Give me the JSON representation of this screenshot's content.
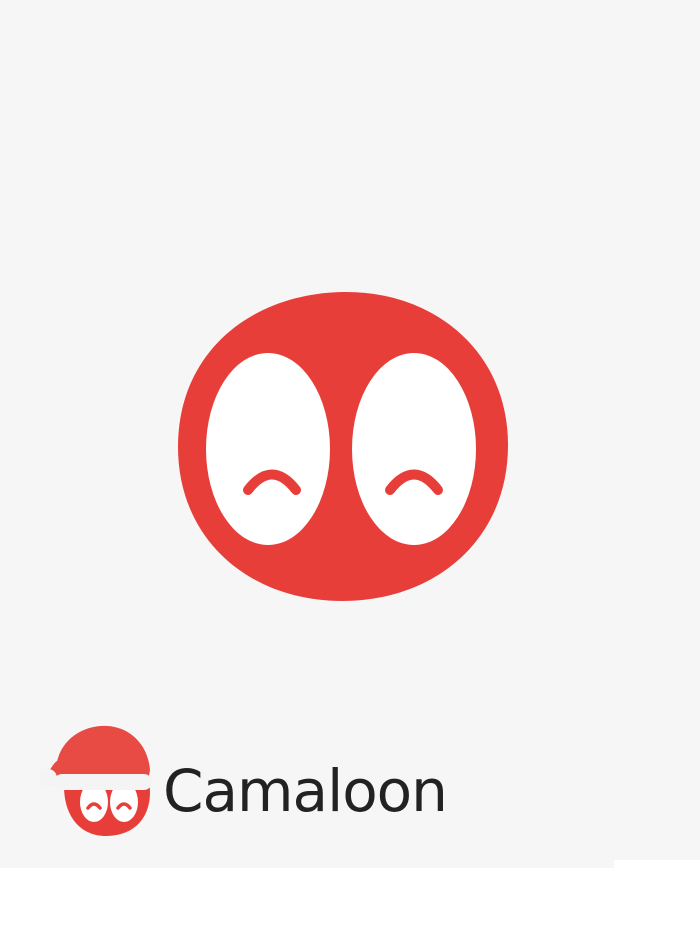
{
  "brand": {
    "name": "Camaloon"
  },
  "colors": {
    "brand_red": "#e83e3a",
    "eye_white": "#ffffff",
    "wordmark": "#222222",
    "background": "#f6f6f6"
  },
  "icons": {
    "mascot": "smiling-face-icon",
    "logo": "santa-hat-face-icon"
  }
}
